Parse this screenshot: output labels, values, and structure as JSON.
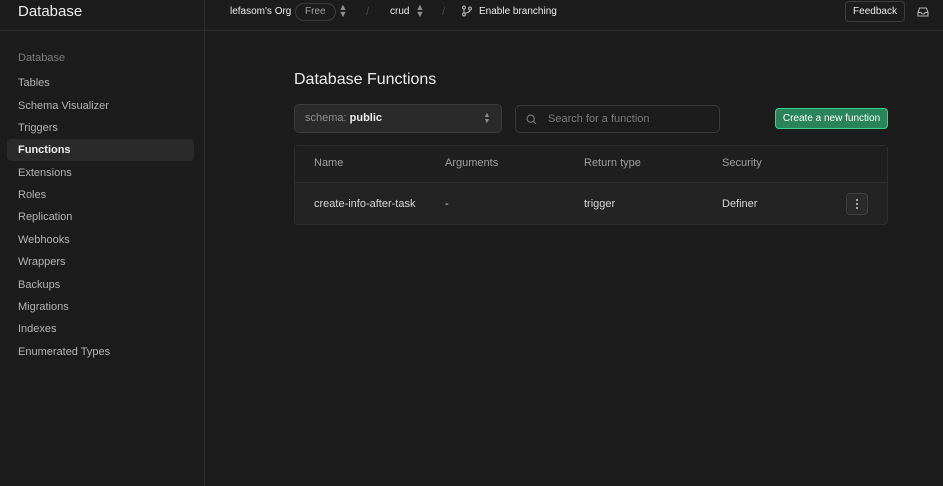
{
  "app": {
    "title": "Database"
  },
  "topbar": {
    "org_name": "lefasom's Org",
    "plan": "Free",
    "separator": "/",
    "project": "crud",
    "branching_label": "Enable branching",
    "feedback_label": "Feedback",
    "icons": {
      "branch": "git-branch-icon",
      "inbox": "inbox-icon",
      "switch": "chevron-up-down-icon"
    }
  },
  "sidebar": {
    "heading": "Database",
    "items": [
      {
        "label": "Tables",
        "active": false
      },
      {
        "label": "Schema Visualizer",
        "active": false
      },
      {
        "label": "Triggers",
        "active": false
      },
      {
        "label": "Functions",
        "active": true
      },
      {
        "label": "Extensions",
        "active": false
      },
      {
        "label": "Roles",
        "active": false
      },
      {
        "label": "Replication",
        "active": false
      },
      {
        "label": "Webhooks",
        "active": false
      },
      {
        "label": "Wrappers",
        "active": false
      },
      {
        "label": "Backups",
        "active": false
      },
      {
        "label": "Migrations",
        "active": false
      },
      {
        "label": "Indexes",
        "active": false
      },
      {
        "label": "Enumerated Types",
        "active": false
      }
    ]
  },
  "main": {
    "title": "Database Functions",
    "schema_select": {
      "prefix": "schema:",
      "value": "public"
    },
    "search": {
      "placeholder": "Search for a function",
      "value": ""
    },
    "create_button": "Create a new function",
    "table": {
      "columns": [
        "Name",
        "Arguments",
        "Return type",
        "Security"
      ],
      "rows": [
        {
          "name": "create-info-after-task",
          "arguments": "-",
          "return_type": "trigger",
          "security": "Definer"
        }
      ]
    }
  },
  "colors": {
    "accent": "#3ecf8e",
    "button_bg": "#29835b",
    "background": "#1c1c1c",
    "border": "#2e2e2e"
  }
}
